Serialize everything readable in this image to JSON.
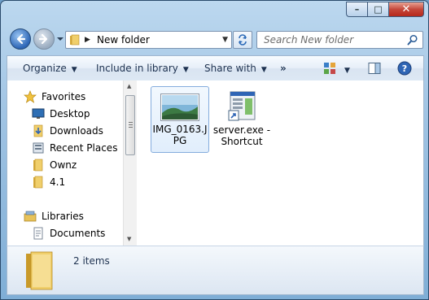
{
  "window": {
    "caption": {
      "minimize_glyph": "–",
      "maximize_glyph": "□",
      "close_glyph": "✕"
    }
  },
  "navigation": {
    "address": "New folder",
    "search_placeholder": "Search New folder"
  },
  "toolbar": {
    "organize": "Organize",
    "include_in_library": "Include in library",
    "share_with": "Share with",
    "more": "»"
  },
  "sidebar": {
    "favorites": {
      "header": "Favorites",
      "items": [
        "Desktop",
        "Downloads",
        "Recent Places",
        "Ownz",
        "4.1"
      ]
    },
    "libraries": {
      "header": "Libraries",
      "items": [
        "Documents"
      ]
    }
  },
  "files": [
    {
      "name_line1": "IMG_0163.J",
      "name_line2": "PG",
      "type": "image",
      "selected": true
    },
    {
      "name_line1": "server.exe -",
      "name_line2": "Shortcut",
      "type": "shortcut",
      "selected": false
    }
  ],
  "status": {
    "item_count": "2 items"
  },
  "colors": {
    "accent": "#2d66b6",
    "toolbar_text": "#1e3250",
    "folder": "#e8c35a"
  }
}
